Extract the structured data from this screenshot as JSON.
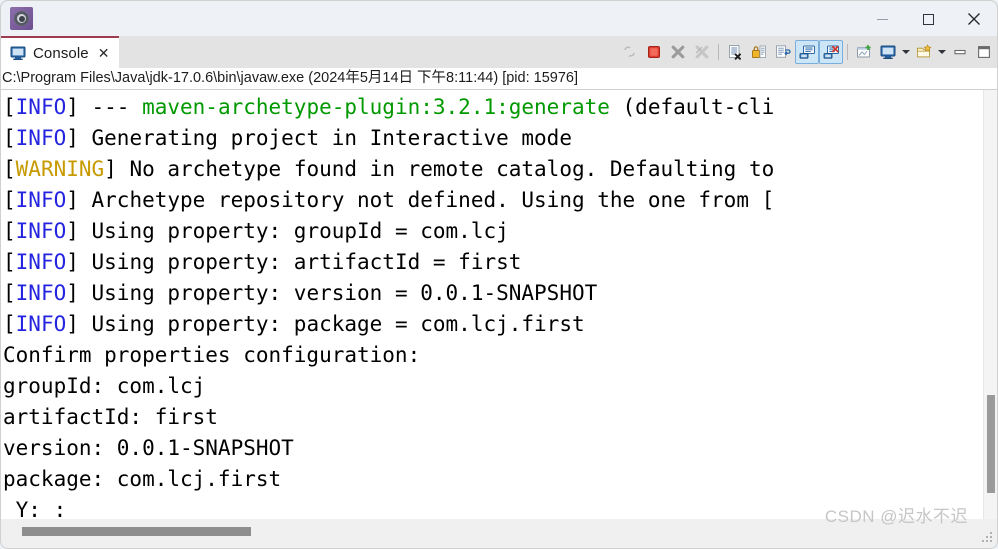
{
  "window": {
    "app_icon_name": "eclipse-app-icon",
    "controls": {
      "minimize": "—",
      "maximize": "☐",
      "close": "✕"
    }
  },
  "tabs": [
    {
      "label": "Console",
      "icon": "console-monitor-icon",
      "close": "✕",
      "active": true
    }
  ],
  "toolbar": {
    "items": [
      {
        "name": "remove-all-terminated-launches-icon",
        "title": "Remove All Terminated Launches",
        "state": "disabled"
      },
      {
        "name": "terminate-icon",
        "title": "Terminate",
        "state": "enabled"
      },
      {
        "name": "remove-launch-icon",
        "title": "Remove Launch",
        "state": "enabled"
      },
      {
        "name": "remove-all-launches-icon",
        "title": "Remove All Launches",
        "state": "disabled"
      },
      {
        "name": "separator-1",
        "title": "",
        "state": "separator"
      },
      {
        "name": "clear-console-icon",
        "title": "Clear Console",
        "state": "enabled"
      },
      {
        "name": "scroll-lock-icon",
        "title": "Scroll Lock",
        "state": "enabled"
      },
      {
        "name": "word-wrap-icon",
        "title": "Word Wrap",
        "state": "enabled"
      },
      {
        "name": "show-console-on-output-icon",
        "title": "Show Console When Standard Out Changes",
        "state": "toggled"
      },
      {
        "name": "show-console-on-error-icon",
        "title": "Show Console When Standard Error Changes",
        "state": "toggled"
      },
      {
        "name": "separator-2",
        "title": "",
        "state": "separator"
      },
      {
        "name": "pin-console-icon",
        "title": "Pin Console",
        "state": "enabled"
      },
      {
        "name": "display-selected-console-icon",
        "title": "Display Selected Console",
        "state": "enabled"
      },
      {
        "name": "display-selected-console-dropdown",
        "title": "Display Selected Console Menu",
        "state": "arrow"
      },
      {
        "name": "open-console-icon",
        "title": "Open Console",
        "state": "enabled"
      },
      {
        "name": "open-console-dropdown",
        "title": "Open Console Menu",
        "state": "arrow"
      },
      {
        "name": "minimize-view-icon",
        "title": "Minimize",
        "state": "enabled"
      },
      {
        "name": "maximize-view-icon",
        "title": "Maximize",
        "state": "enabled"
      }
    ]
  },
  "console": {
    "process_label": "C:\\Program Files\\Java\\jdk-17.0.6\\bin\\javaw.exe (2024年5月14日 下午8:11:44) [pid: 15976]",
    "lines": [
      [
        {
          "text": "[",
          "style": "plain"
        },
        {
          "text": "INFO",
          "style": "info"
        },
        {
          "text": "] --- ",
          "style": "plain"
        },
        {
          "text": "maven-archetype-plugin:3.2.1:generate",
          "style": "green"
        },
        {
          "text": " (default-cli",
          "style": "plain"
        }
      ],
      [
        {
          "text": "[",
          "style": "plain"
        },
        {
          "text": "INFO",
          "style": "info"
        },
        {
          "text": "] Generating project in Interactive mode",
          "style": "plain"
        }
      ],
      [
        {
          "text": "[",
          "style": "plain"
        },
        {
          "text": "WARNING",
          "style": "warning"
        },
        {
          "text": "] No archetype found in remote catalog. Defaulting to",
          "style": "plain"
        }
      ],
      [
        {
          "text": "[",
          "style": "plain"
        },
        {
          "text": "INFO",
          "style": "info"
        },
        {
          "text": "] Archetype repository not defined. Using the one from [",
          "style": "plain"
        }
      ],
      [
        {
          "text": "[",
          "style": "plain"
        },
        {
          "text": "INFO",
          "style": "info"
        },
        {
          "text": "] Using property: groupId = com.lcj",
          "style": "plain"
        }
      ],
      [
        {
          "text": "[",
          "style": "plain"
        },
        {
          "text": "INFO",
          "style": "info"
        },
        {
          "text": "] Using property: artifactId = first",
          "style": "plain"
        }
      ],
      [
        {
          "text": "[",
          "style": "plain"
        },
        {
          "text": "INFO",
          "style": "info"
        },
        {
          "text": "] Using property: version = 0.0.1-SNAPSHOT",
          "style": "plain"
        }
      ],
      [
        {
          "text": "[",
          "style": "plain"
        },
        {
          "text": "INFO",
          "style": "info"
        },
        {
          "text": "] Using property: package = com.lcj.first",
          "style": "plain"
        }
      ],
      [
        {
          "text": "Confirm properties configuration:",
          "style": "plain"
        }
      ],
      [
        {
          "text": "groupId: com.lcj",
          "style": "plain"
        }
      ],
      [
        {
          "text": "artifactId: first",
          "style": "plain"
        }
      ],
      [
        {
          "text": "version: 0.0.1-SNAPSHOT",
          "style": "plain"
        }
      ],
      [
        {
          "text": "package: com.lcj.first",
          "style": "plain"
        }
      ],
      [
        {
          "text": " Y: :",
          "style": "plain"
        }
      ]
    ]
  },
  "scrollbars": {
    "vertical_name": "console-vertical-scrollbar",
    "horizontal_name": "console-horizontal-scrollbar"
  },
  "watermark": "CSDN @迟水不迟",
  "colors": {
    "info": "#2424e0",
    "warning": "#c79b00",
    "green": "#009900",
    "tab_accent": "#9e3b52",
    "toggle_highlight": "#cde6f7"
  }
}
